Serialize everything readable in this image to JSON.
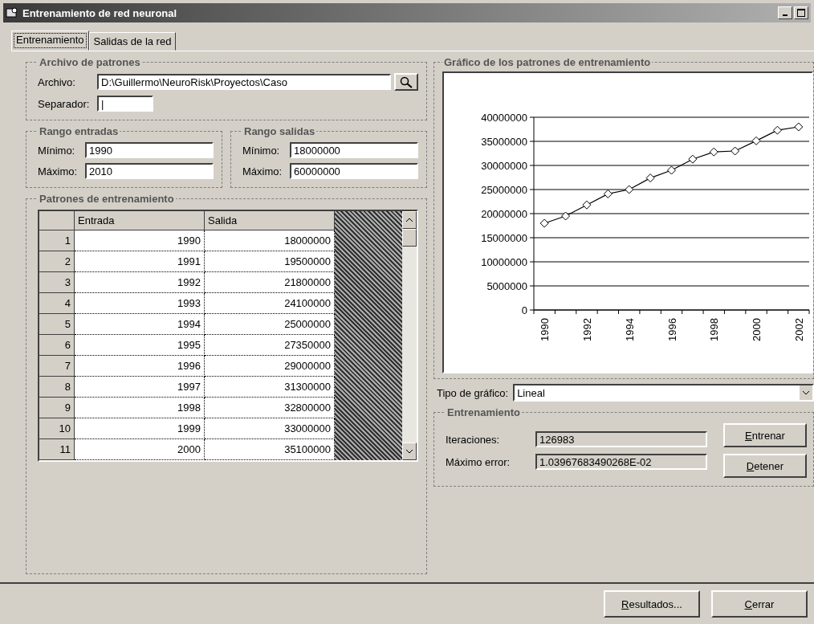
{
  "window": {
    "title": "Entrenamiento de red neuronal"
  },
  "tabs": [
    {
      "label": "Entrenamiento",
      "selected": true
    },
    {
      "label": "Salidas de la red",
      "selected": false
    }
  ],
  "patterns_file": {
    "title": "Archivo de patrones",
    "file_label": "Archivo:",
    "file_value": "D:\\Guillermo\\NeuroRisk\\Proyectos\\Caso",
    "separator_label": "Separador:",
    "separator_value": "|"
  },
  "input_range": {
    "title": "Rango entradas",
    "min_label": "Mínimo:",
    "min_value": "1990",
    "max_label": "Máximo:",
    "max_value": "2010"
  },
  "output_range": {
    "title": "Rango salidas",
    "min_label": "Mínimo:",
    "min_value": "18000000",
    "max_label": "Máximo:",
    "max_value": "60000000"
  },
  "patterns_table": {
    "title": "Patrones de entrenamiento",
    "columns": [
      "Entrada",
      "Salida"
    ],
    "rows": [
      {
        "index": "1",
        "cells": [
          "1990",
          "18000000"
        ]
      },
      {
        "index": "2",
        "cells": [
          "1991",
          "19500000"
        ]
      },
      {
        "index": "3",
        "cells": [
          "1992",
          "21800000"
        ]
      },
      {
        "index": "4",
        "cells": [
          "1993",
          "24100000"
        ]
      },
      {
        "index": "5",
        "cells": [
          "1994",
          "25000000"
        ]
      },
      {
        "index": "6",
        "cells": [
          "1995",
          "27350000"
        ]
      },
      {
        "index": "7",
        "cells": [
          "1996",
          "29000000"
        ]
      },
      {
        "index": "8",
        "cells": [
          "1997",
          "31300000"
        ]
      },
      {
        "index": "9",
        "cells": [
          "1998",
          "32800000"
        ]
      },
      {
        "index": "10",
        "cells": [
          "1999",
          "33000000"
        ]
      },
      {
        "index": "11",
        "cells": [
          "2000",
          "35100000"
        ]
      }
    ]
  },
  "chart_panel": {
    "title": "Gráfico de los patrones de entrenamiento",
    "chart_data": {
      "type": "line",
      "x": [
        1990,
        1991,
        1992,
        1993,
        1994,
        1995,
        1996,
        1997,
        1998,
        1999,
        2000,
        2001,
        2002
      ],
      "series": [
        {
          "color": "#000000",
          "marker": "diamond",
          "values": [
            18000000,
            19500000,
            21800000,
            24100000,
            25000000,
            27400000,
            29000000,
            31300000,
            32800000,
            33000000,
            35100000,
            37300000,
            38000000
          ]
        }
      ],
      "xlim": [
        1989.5,
        2002.5
      ],
      "grid": true,
      "ylim": [
        0,
        40000000
      ],
      "yticks": [
        0,
        5000000,
        10000000,
        15000000,
        20000000,
        25000000,
        30000000,
        35000000,
        40000000
      ],
      "xticks": [
        1990,
        1992,
        1994,
        1996,
        1998,
        2000,
        2002
      ]
    }
  },
  "chart_type": {
    "label": "Tipo de gráfico:",
    "value": "Lineal"
  },
  "training": {
    "title": "Entrenamiento",
    "iterations_label": "Iteraciones:",
    "iterations_value": "126983",
    "error_label": "Máximo error:",
    "error_value": "1.03967683490268E-02",
    "buttons": [
      "Entrenar",
      "Detener"
    ]
  },
  "footer_buttons": [
    "Resultados...",
    "Cerrar"
  ]
}
